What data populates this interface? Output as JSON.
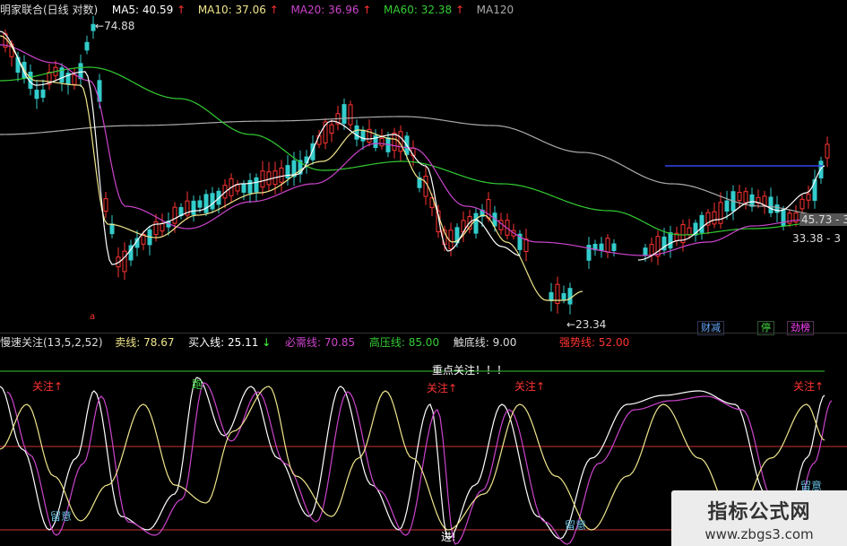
{
  "main_header": {
    "title": "明家联合(日线 对数)",
    "ma5_label": "MA5:",
    "ma5_value": "40.59",
    "ma10_label": "MA10:",
    "ma10_value": "37.06",
    "ma20_label": "MA20:",
    "ma20_value": "36.96",
    "ma60_label": "MA60:",
    "ma60_value": "32.38",
    "ma120_label": "MA120",
    "arrow": "↑",
    "colors": {
      "ma5": "#ffffff",
      "ma10": "#f0e68c",
      "ma20": "#cc44cc",
      "ma60": "#33cc33",
      "ma120": "#aaaaaa",
      "arrow": "#ff3333"
    }
  },
  "main_annotations": {
    "high_price": "74.88",
    "low_price": "23.34",
    "right_price_1": "45.73 - 3",
    "right_price_2": "33.38 - 3",
    "small_marker": "a"
  },
  "badges": [
    {
      "text": "财减",
      "color": "#66aaff"
    },
    {
      "text": "停",
      "color": "#44dd44"
    },
    {
      "text": "劲榜",
      "color": "#ff44ff"
    }
  ],
  "indicator_header": {
    "name": "慢速关注(13,5,2,52)",
    "sell_label": "卖线:",
    "sell_value": "78.67",
    "buy_label": "买入线:",
    "buy_value": "25.11",
    "buy_arrow": "↓",
    "must_rise_label": "必需线:",
    "must_rise_value": "70.85",
    "high_pressure_label": "高压线:",
    "high_pressure_value": "85.00",
    "bottom_label": "触底线:",
    "bottom_value": "9.00",
    "strong_label": "强势线:",
    "strong_value": "52.00"
  },
  "indicator_annotations": {
    "focus_title": "重点关注！！！",
    "attention": "关注",
    "run": "跑",
    "caution": "留意",
    "enter": "进"
  },
  "watermark": {
    "title": "指标公式网",
    "url": "www.zbgs3.com"
  },
  "chart_data": [
    {
      "type": "candlestick",
      "title": "明家联合(日线 对数)",
      "series": [
        {
          "name": "MA5",
          "value": 40.59,
          "color": "#ffffff"
        },
        {
          "name": "MA10",
          "value": 37.06,
          "color": "#f0e68c"
        },
        {
          "name": "MA20",
          "value": 36.96,
          "color": "#cc44cc"
        },
        {
          "name": "MA60",
          "value": 32.38,
          "color": "#33cc33"
        },
        {
          "name": "MA120",
          "color": "#aaaaaa"
        }
      ],
      "annotations": [
        "74.88",
        "23.34",
        "45.73",
        "33.38"
      ]
    },
    {
      "type": "line",
      "title": "慢速关注(13,5,2,52)",
      "series": [
        {
          "name": "卖线",
          "value": 78.67,
          "color": "#f0e68c"
        },
        {
          "name": "买入线",
          "value": 25.11,
          "color": "#ffffff"
        },
        {
          "name": "必需线",
          "value": 70.85,
          "color": "#cc44cc"
        },
        {
          "name": "高压线",
          "value": 85.0,
          "color": "#33cc33"
        },
        {
          "name": "触底线",
          "value": 9.0,
          "color": "#cc3333"
        },
        {
          "name": "强势线",
          "value": 52.0,
          "color": "#cc3333"
        }
      ]
    }
  ]
}
